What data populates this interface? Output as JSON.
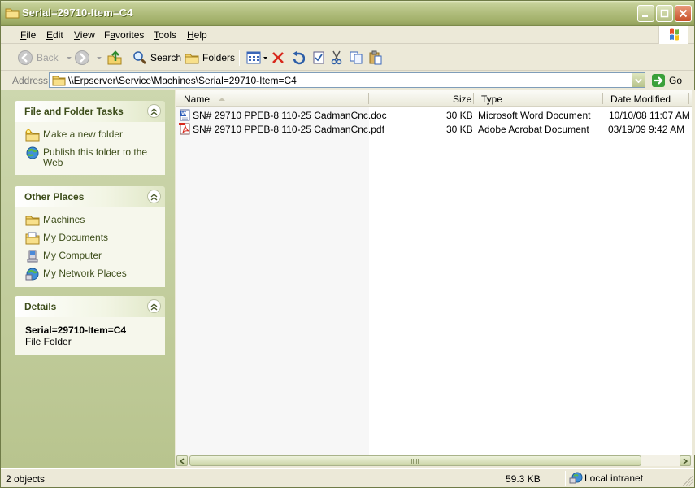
{
  "window": {
    "title": "Serial=29710-Item=C4"
  },
  "menu": {
    "items": [
      {
        "pre": "",
        "key": "F",
        "post": "ile"
      },
      {
        "pre": "",
        "key": "E",
        "post": "dit"
      },
      {
        "pre": "",
        "key": "V",
        "post": "iew"
      },
      {
        "pre": "F",
        "key": "a",
        "post": "vorites"
      },
      {
        "pre": "",
        "key": "T",
        "post": "ools"
      },
      {
        "pre": "",
        "key": "H",
        "post": "elp"
      }
    ]
  },
  "toolbar": {
    "back": "Back",
    "search": "Search",
    "folders": "Folders"
  },
  "address": {
    "label": "Address",
    "path": "\\\\Erpserver\\Service\\Machines\\Serial=29710-Item=C4",
    "go": "Go"
  },
  "tasks": {
    "title": "File and Folder Tasks",
    "items": [
      "Make a new folder",
      "Publish this folder to the Web"
    ]
  },
  "places": {
    "title": "Other Places",
    "items": [
      "Machines",
      "My Documents",
      "My Computer",
      "My Network Places"
    ]
  },
  "details": {
    "title": "Details",
    "name": "Serial=29710-Item=C4",
    "type": "File Folder"
  },
  "columns": {
    "name": "Name",
    "size": "Size",
    "type": "Type",
    "modified": "Date Modified"
  },
  "files": [
    {
      "name": "SN# 29710 PPEB-8 110-25 CadmanCnc.doc",
      "size": "30 KB",
      "type": "Microsoft Word Document",
      "modified": "10/10/08 11:07 AM",
      "icon": "word-doc-icon"
    },
    {
      "name": "SN# 29710 PPEB-8 110-25 CadmanCnc.pdf",
      "size": "30 KB",
      "type": "Adobe Acrobat Document",
      "modified": "03/19/09 9:42 AM",
      "icon": "pdf-icon"
    }
  ],
  "status": {
    "objects": "2 objects",
    "size": "59.3 KB",
    "zone": "Local intranet"
  }
}
